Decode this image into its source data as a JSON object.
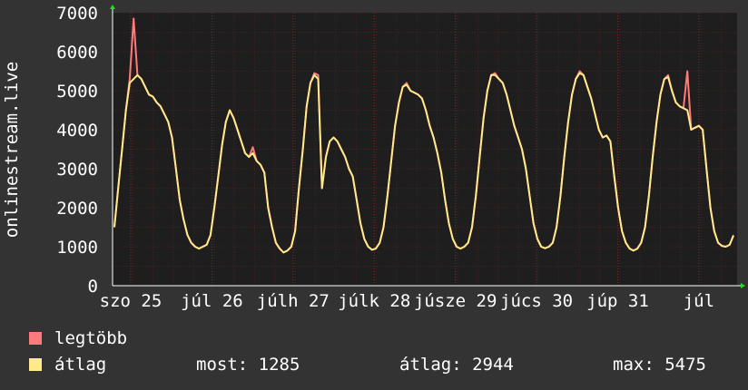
{
  "chart_data": {
    "type": "line",
    "ylabel": "onlinestream.live",
    "ylim": [
      0,
      7000
    ],
    "yticks": [
      0,
      1000,
      2000,
      3000,
      4000,
      5000,
      6000,
      7000
    ],
    "x_tick_labels": [
      "szo 25",
      "júl 26",
      "júlh 27",
      "júlk 28",
      "júsze 29",
      "júcs 30",
      "júp 31",
      "júl"
    ],
    "grid": true,
    "colors": {
      "background": "#333333",
      "plot": "#1e1e1e",
      "grid": "#4a2020",
      "axis": "#ffffff",
      "arrow": "#22dd22",
      "max_line": "#ff7b7b",
      "avg_line": "#ffe98a"
    },
    "series": [
      {
        "name": "legtöbb",
        "color": "#ff7b7b",
        "values": [
          1500,
          2500,
          3500,
          4500,
          5300,
          6850,
          5400,
          5300,
          5100,
          4900,
          4850,
          4700,
          4600,
          4400,
          4200,
          3800,
          3000,
          2200,
          1700,
          1300,
          1100,
          1000,
          950,
          1000,
          1050,
          1300,
          2000,
          2800,
          3600,
          4200,
          4500,
          4300,
          4000,
          3700,
          3400,
          3300,
          3550,
          3200,
          3100,
          2900,
          2000,
          1500,
          1100,
          950,
          850,
          900,
          1000,
          1400,
          2500,
          3500,
          4600,
          5200,
          5450,
          5400,
          2500,
          3300,
          3700,
          3800,
          3700,
          3500,
          3300,
          3000,
          2800,
          2200,
          1600,
          1200,
          1000,
          920,
          950,
          1100,
          1500,
          2300,
          3200,
          4100,
          4700,
          5100,
          5200,
          5000,
          4950,
          4900,
          4800,
          4500,
          4100,
          3800,
          3400,
          2900,
          2200,
          1600,
          1200,
          1000,
          950,
          1000,
          1100,
          1500,
          2300,
          3300,
          4300,
          5000,
          5400,
          5450,
          5300,
          5200,
          4900,
          4500,
          4100,
          3800,
          3500,
          3000,
          2300,
          1600,
          1200,
          1000,
          960,
          1000,
          1100,
          1500,
          2300,
          3300,
          4200,
          4900,
          5300,
          5500,
          5400,
          5100,
          4800,
          4400,
          4000,
          3800,
          3850,
          3700,
          2800,
          2000,
          1400,
          1100,
          950,
          900,
          950,
          1100,
          1500,
          2300,
          3300,
          4200,
          4900,
          5300,
          5400,
          5000,
          4700,
          4600,
          4550,
          5500,
          4000,
          4050,
          4100,
          4000,
          3000,
          2000,
          1400,
          1100,
          1020,
          1000,
          1050,
          1300
        ]
      },
      {
        "name": "átlag",
        "color": "#ffe98a",
        "values": [
          1500,
          2500,
          3500,
          4500,
          5200,
          5300,
          5400,
          5300,
          5100,
          4900,
          4850,
          4700,
          4600,
          4400,
          4200,
          3800,
          3000,
          2200,
          1700,
          1300,
          1100,
          1000,
          950,
          1000,
          1050,
          1300,
          2000,
          2800,
          3600,
          4200,
          4500,
          4300,
          4000,
          3700,
          3400,
          3300,
          3400,
          3200,
          3100,
          2900,
          2000,
          1500,
          1100,
          950,
          850,
          900,
          1000,
          1400,
          2500,
          3500,
          4600,
          5200,
          5400,
          5300,
          2500,
          3300,
          3700,
          3800,
          3700,
          3500,
          3300,
          3000,
          2800,
          2200,
          1600,
          1200,
          1000,
          920,
          950,
          1100,
          1500,
          2300,
          3200,
          4100,
          4700,
          5100,
          5150,
          5000,
          4950,
          4900,
          4800,
          4500,
          4100,
          3800,
          3400,
          2900,
          2200,
          1600,
          1200,
          1000,
          950,
          1000,
          1100,
          1500,
          2300,
          3300,
          4300,
          5000,
          5400,
          5400,
          5300,
          5200,
          4900,
          4500,
          4100,
          3800,
          3500,
          3000,
          2300,
          1600,
          1200,
          1000,
          960,
          1000,
          1100,
          1500,
          2300,
          3300,
          4200,
          4900,
          5300,
          5450,
          5400,
          5100,
          4800,
          4400,
          4000,
          3800,
          3850,
          3700,
          2800,
          2000,
          1400,
          1100,
          950,
          900,
          950,
          1100,
          1500,
          2300,
          3300,
          4200,
          4900,
          5300,
          5350,
          5000,
          4700,
          4600,
          4550,
          4500,
          4000,
          4050,
          4100,
          4000,
          3000,
          2000,
          1400,
          1100,
          1020,
          1000,
          1050,
          1285
        ]
      }
    ]
  },
  "legend": {
    "max_label": "legtöbb",
    "avg_label": "átlag"
  },
  "stats": {
    "now": "most: 1285",
    "avg": "átlag: 2944",
    "max": "max: 5475"
  }
}
